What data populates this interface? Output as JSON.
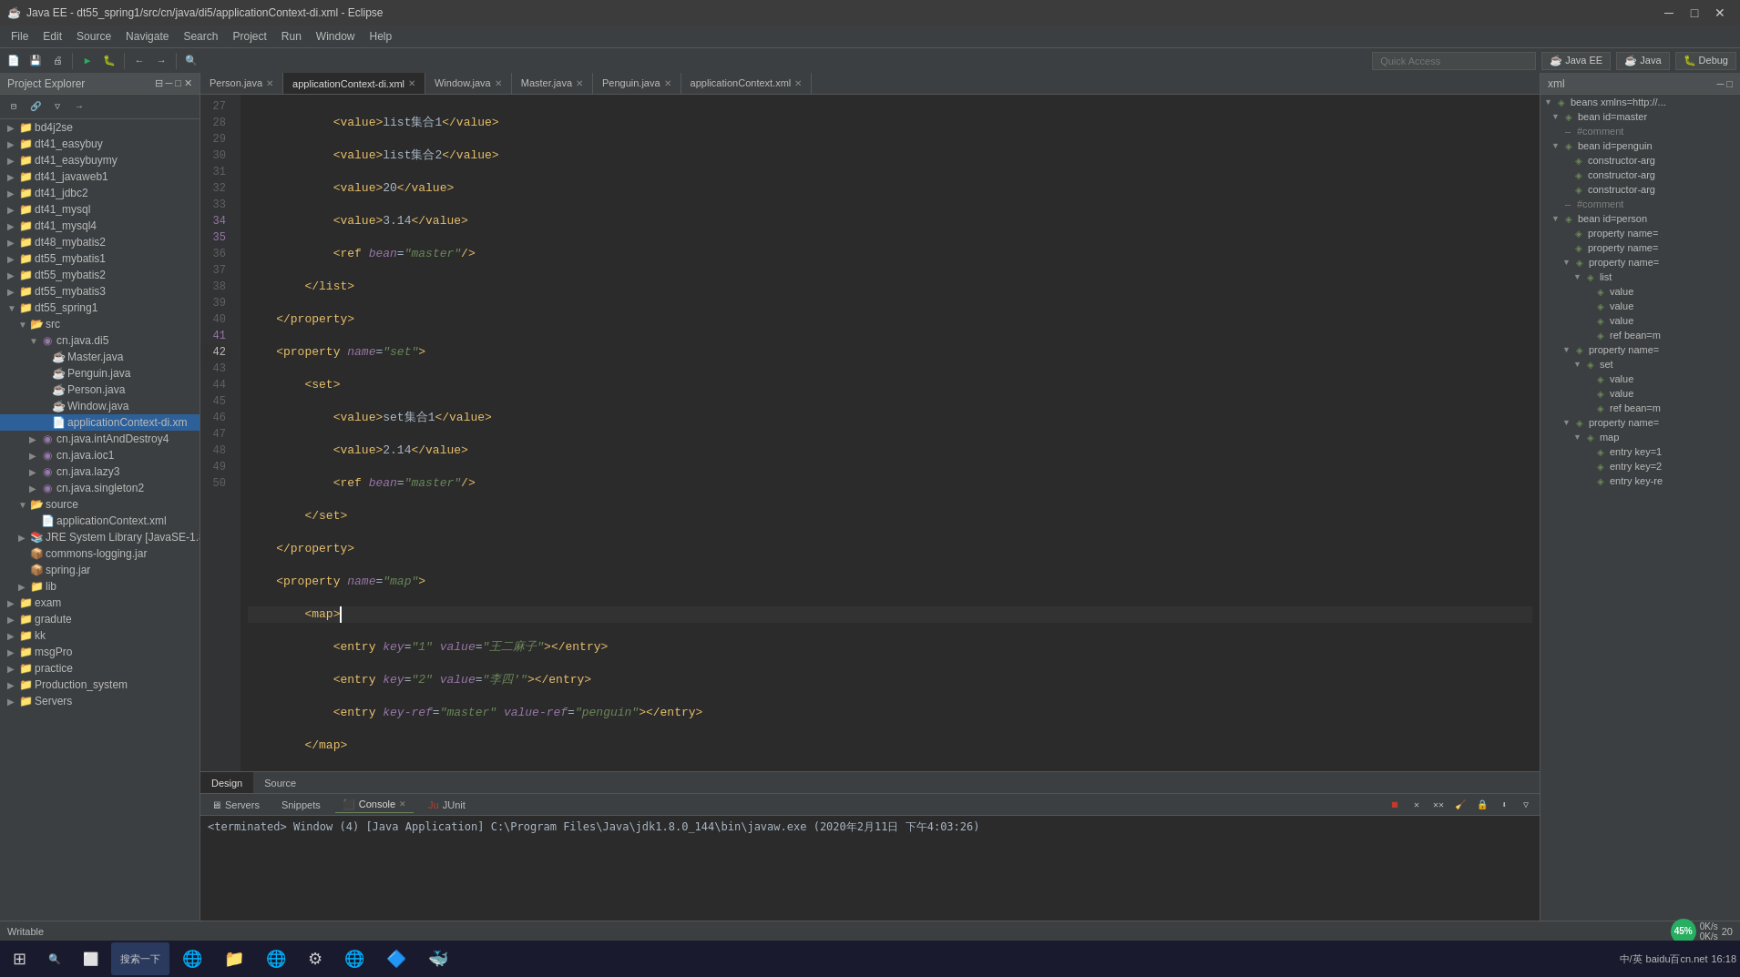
{
  "titleBar": {
    "title": "Java EE - dt55_spring1/src/cn/java/di5/applicationContext-di.xml - Eclipse",
    "minBtn": "─",
    "maxBtn": "□",
    "closeBtn": "✕"
  },
  "menuBar": {
    "items": [
      "File",
      "Edit",
      "Source",
      "Navigate",
      "Search",
      "Project",
      "Run",
      "Window",
      "Help"
    ]
  },
  "quickAccess": {
    "placeholder": "Quick Access",
    "perspectives": [
      "Java EE",
      "Java",
      "Debug"
    ]
  },
  "editorTabs": [
    {
      "label": "Person.java",
      "active": false
    },
    {
      "label": "applicationContext-di.xml",
      "active": true
    },
    {
      "label": "Window.java",
      "active": false
    },
    {
      "label": "Master.java",
      "active": false
    },
    {
      "label": "Penguin.java",
      "active": false
    },
    {
      "label": "applicationContext.xml",
      "active": false
    }
  ],
  "bottomTabs": [
    {
      "label": "Design",
      "active": true
    },
    {
      "label": "Source",
      "active": false
    }
  ],
  "consoleTabs": [
    {
      "label": "Servers",
      "active": false
    },
    {
      "label": "Snippets",
      "active": false
    },
    {
      "label": "Console",
      "active": true
    },
    {
      "label": "JUnit",
      "active": false
    }
  ],
  "consoleText": "<terminated> Window (4) [Java Application] C:\\Program Files\\Java\\jdk1.8.0_144\\bin\\javaw.exe (2020年2月11日 下午4:03:26)",
  "statusBar": {
    "text": "Writable",
    "progressPct": "45%",
    "speed1": "0K/s",
    "speed2": "0K/s",
    "num": "20"
  },
  "projectExplorer": {
    "title": "Project Explorer",
    "items": [
      {
        "indent": 1,
        "label": "bd4j2se",
        "arrow": "▶",
        "icon": "📁",
        "type": "folder"
      },
      {
        "indent": 1,
        "label": "dt41_easybuy",
        "arrow": "▶",
        "icon": "📁",
        "type": "folder"
      },
      {
        "indent": 1,
        "label": "dt41_easybuymy",
        "arrow": "▶",
        "icon": "📁",
        "type": "folder"
      },
      {
        "indent": 1,
        "label": "dt41_javaweb1",
        "arrow": "▶",
        "icon": "📁",
        "type": "folder"
      },
      {
        "indent": 1,
        "label": "dt41_jdbc2",
        "arrow": "▶",
        "icon": "📁",
        "type": "folder"
      },
      {
        "indent": 1,
        "label": "dt41_mysql",
        "arrow": "▶",
        "icon": "📁",
        "type": "folder"
      },
      {
        "indent": 1,
        "label": "dt41_mysql4",
        "arrow": "▶",
        "icon": "📁",
        "type": "folder"
      },
      {
        "indent": 1,
        "label": "dt48_mybatis2",
        "arrow": "▶",
        "icon": "📁",
        "type": "folder"
      },
      {
        "indent": 1,
        "label": "dt55_mybatis1",
        "arrow": "▶",
        "icon": "📁",
        "type": "folder"
      },
      {
        "indent": 1,
        "label": "dt55_mybatis2",
        "arrow": "▶",
        "icon": "📁",
        "type": "folder"
      },
      {
        "indent": 1,
        "label": "dt55_mybatis3",
        "arrow": "▶",
        "icon": "📁",
        "type": "folder"
      },
      {
        "indent": 1,
        "label": "dt55_spring1",
        "arrow": "▼",
        "icon": "📁",
        "type": "folder",
        "expanded": true
      },
      {
        "indent": 2,
        "label": "src",
        "arrow": "▼",
        "icon": "📂",
        "type": "folder",
        "expanded": true
      },
      {
        "indent": 3,
        "label": "cn.java.di5",
        "arrow": "▼",
        "icon": "📦",
        "type": "package",
        "expanded": true
      },
      {
        "indent": 4,
        "label": "Master.java",
        "arrow": "",
        "icon": "☕",
        "type": "java"
      },
      {
        "indent": 4,
        "label": "Penguin.java",
        "arrow": "",
        "icon": "☕",
        "type": "java"
      },
      {
        "indent": 4,
        "label": "Person.java",
        "arrow": "",
        "icon": "☕",
        "type": "java"
      },
      {
        "indent": 4,
        "label": "Window.java",
        "arrow": "",
        "icon": "☕",
        "type": "java"
      },
      {
        "indent": 4,
        "label": "applicationContext-di.xm",
        "arrow": "",
        "icon": "📄",
        "type": "xml",
        "selected": true
      },
      {
        "indent": 3,
        "label": "cn.java.intAndDestroy4",
        "arrow": "▶",
        "icon": "📦",
        "type": "package"
      },
      {
        "indent": 3,
        "label": "cn.java.ioc1",
        "arrow": "▶",
        "icon": "📦",
        "type": "package"
      },
      {
        "indent": 3,
        "label": "cn.java.lazy3",
        "arrow": "▶",
        "icon": "📦",
        "type": "package"
      },
      {
        "indent": 3,
        "label": "cn.java.singleton2",
        "arrow": "▶",
        "icon": "📦",
        "type": "package"
      },
      {
        "indent": 2,
        "label": "source",
        "arrow": "▼",
        "icon": "📂",
        "type": "folder"
      },
      {
        "indent": 3,
        "label": "applicationContext.xml",
        "arrow": "",
        "icon": "📄",
        "type": "xml"
      },
      {
        "indent": 2,
        "label": "JRE System Library [JavaSE-1.8",
        "arrow": "▶",
        "icon": "📚",
        "type": "lib"
      },
      {
        "indent": 2,
        "label": "commons-logging.jar",
        "arrow": "",
        "icon": "📦",
        "type": "jar"
      },
      {
        "indent": 2,
        "label": "spring.jar",
        "arrow": "",
        "icon": "📦",
        "type": "jar"
      },
      {
        "indent": 2,
        "label": "lib",
        "arrow": "▶",
        "icon": "📁",
        "type": "folder"
      },
      {
        "indent": 1,
        "label": "exam",
        "arrow": "▶",
        "icon": "📁",
        "type": "folder"
      },
      {
        "indent": 1,
        "label": "gradute",
        "arrow": "▶",
        "icon": "📁",
        "type": "folder"
      },
      {
        "indent": 1,
        "label": "kk",
        "arrow": "▶",
        "icon": "📁",
        "type": "folder"
      },
      {
        "indent": 1,
        "label": "msgPro",
        "arrow": "▶",
        "icon": "📁",
        "type": "folder"
      },
      {
        "indent": 1,
        "label": "practice",
        "arrow": "▶",
        "icon": "📁",
        "type": "folder"
      },
      {
        "indent": 1,
        "label": "Production_system",
        "arrow": "▶",
        "icon": "📁",
        "type": "folder"
      },
      {
        "indent": 1,
        "label": "Servers",
        "arrow": "▶",
        "icon": "📁",
        "type": "folder"
      }
    ]
  },
  "codeLines": [
    {
      "num": 27,
      "content": "            <value>list集合1</value>",
      "highlight": false
    },
    {
      "num": 28,
      "content": "            <value>list集合2</value>",
      "highlight": false
    },
    {
      "num": 29,
      "content": "            <value>20</value>",
      "highlight": false
    },
    {
      "num": 30,
      "content": "            <value>3.14</value>",
      "highlight": false
    },
    {
      "num": 31,
      "content": "            <ref bean=\"master\"/>",
      "highlight": false
    },
    {
      "num": 32,
      "content": "        </list>",
      "highlight": false
    },
    {
      "num": 33,
      "content": "    </property>",
      "highlight": false
    },
    {
      "num": 34,
      "content": "    <property name=\"set\">",
      "highlight": false
    },
    {
      "num": 35,
      "content": "        <set>",
      "highlight": false
    },
    {
      "num": 36,
      "content": "            <value>set集合1</value>",
      "highlight": false
    },
    {
      "num": 37,
      "content": "            <value>2.14</value>",
      "highlight": false
    },
    {
      "num": 38,
      "content": "            <ref bean=\"master\"/>",
      "highlight": false
    },
    {
      "num": 39,
      "content": "        </set>",
      "highlight": false
    },
    {
      "num": 40,
      "content": "    </property>",
      "highlight": false
    },
    {
      "num": 41,
      "content": "    <property name=\"map\">",
      "highlight": false
    },
    {
      "num": 42,
      "content": "        <map>|",
      "highlight": true,
      "current": true
    },
    {
      "num": 43,
      "content": "            <entry key=\"1\" value=\"王二麻子\"></entry>",
      "highlight": false
    },
    {
      "num": 44,
      "content": "            <entry key=\"2\" value=\"李四'\"></entry>",
      "highlight": false
    },
    {
      "num": 45,
      "content": "            <entry key-ref=\"master\" value-ref=\"penguin\"></entry>",
      "highlight": false
    },
    {
      "num": 46,
      "content": "        </map>",
      "highlight": false
    },
    {
      "num": 47,
      "content": "    </property>",
      "highlight": false
    },
    {
      "num": 48,
      "content": "    </bean>",
      "highlight": false
    },
    {
      "num": 49,
      "content": "</beans>",
      "highlight": false
    },
    {
      "num": 50,
      "content": "",
      "highlight": false
    }
  ],
  "outlinePanel": {
    "title": "xml",
    "items": [
      {
        "indent": 0,
        "label": "beans xmlns=http://...",
        "icon": "◈",
        "arrow": ""
      },
      {
        "indent": 1,
        "label": "bean id=master",
        "icon": "◈",
        "arrow": "▼"
      },
      {
        "indent": 1,
        "label": "-- #comment",
        "icon": "·",
        "arrow": ""
      },
      {
        "indent": 1,
        "label": "bean id=penguin",
        "icon": "◈",
        "arrow": "▼"
      },
      {
        "indent": 2,
        "label": "constructor-arg",
        "icon": "◈",
        "arrow": ""
      },
      {
        "indent": 2,
        "label": "constructor-arg",
        "icon": "◈",
        "arrow": ""
      },
      {
        "indent": 2,
        "label": "constructor-arg",
        "icon": "◈",
        "arrow": ""
      },
      {
        "indent": 1,
        "label": "-- #comment",
        "icon": "·",
        "arrow": ""
      },
      {
        "indent": 1,
        "label": "bean id=person",
        "icon": "◈",
        "arrow": "▼"
      },
      {
        "indent": 2,
        "label": "property name=",
        "icon": "◈",
        "arrow": ""
      },
      {
        "indent": 2,
        "label": "property name=",
        "icon": "◈",
        "arrow": ""
      },
      {
        "indent": 2,
        "label": "property name=",
        "icon": "◈",
        "arrow": "▼"
      },
      {
        "indent": 3,
        "label": "list",
        "icon": "◈",
        "arrow": "▼"
      },
      {
        "indent": 4,
        "label": "value",
        "icon": "◈",
        "arrow": ""
      },
      {
        "indent": 4,
        "label": "value",
        "icon": "◈",
        "arrow": ""
      },
      {
        "indent": 4,
        "label": "value",
        "icon": "◈",
        "arrow": ""
      },
      {
        "indent": 4,
        "label": "ref bean=m",
        "icon": "◈",
        "arrow": ""
      },
      {
        "indent": 2,
        "label": "property name=",
        "icon": "◈",
        "arrow": "▼"
      },
      {
        "indent": 3,
        "label": "set",
        "icon": "◈",
        "arrow": "▼"
      },
      {
        "indent": 4,
        "label": "value",
        "icon": "◈",
        "arrow": ""
      },
      {
        "indent": 4,
        "label": "value",
        "icon": "◈",
        "arrow": ""
      },
      {
        "indent": 4,
        "label": "ref bean=m",
        "icon": "◈",
        "arrow": ""
      },
      {
        "indent": 2,
        "label": "property name=",
        "icon": "◈",
        "arrow": "▼"
      },
      {
        "indent": 3,
        "label": "map",
        "icon": "◈",
        "arrow": "▼"
      },
      {
        "indent": 4,
        "label": "entry key=1",
        "icon": "◈",
        "arrow": ""
      },
      {
        "indent": 4,
        "label": "entry key=2",
        "icon": "◈",
        "arrow": ""
      },
      {
        "indent": 4,
        "label": "entry key-re",
        "icon": "◈",
        "arrow": ""
      }
    ]
  },
  "taskbar": {
    "startBtn": "⊞",
    "apps": [
      "搜索一下",
      "🌐",
      "📁",
      "🌐",
      "⚙",
      "🌐",
      "🔷",
      "🐳"
    ],
    "appLabels": [
      "搜索一下",
      "",
      "",
      "",
      "",
      "",
      "",
      ""
    ],
    "rightItems": [
      "中/英",
      "baidu百cn.net",
      "16:18"
    ]
  }
}
